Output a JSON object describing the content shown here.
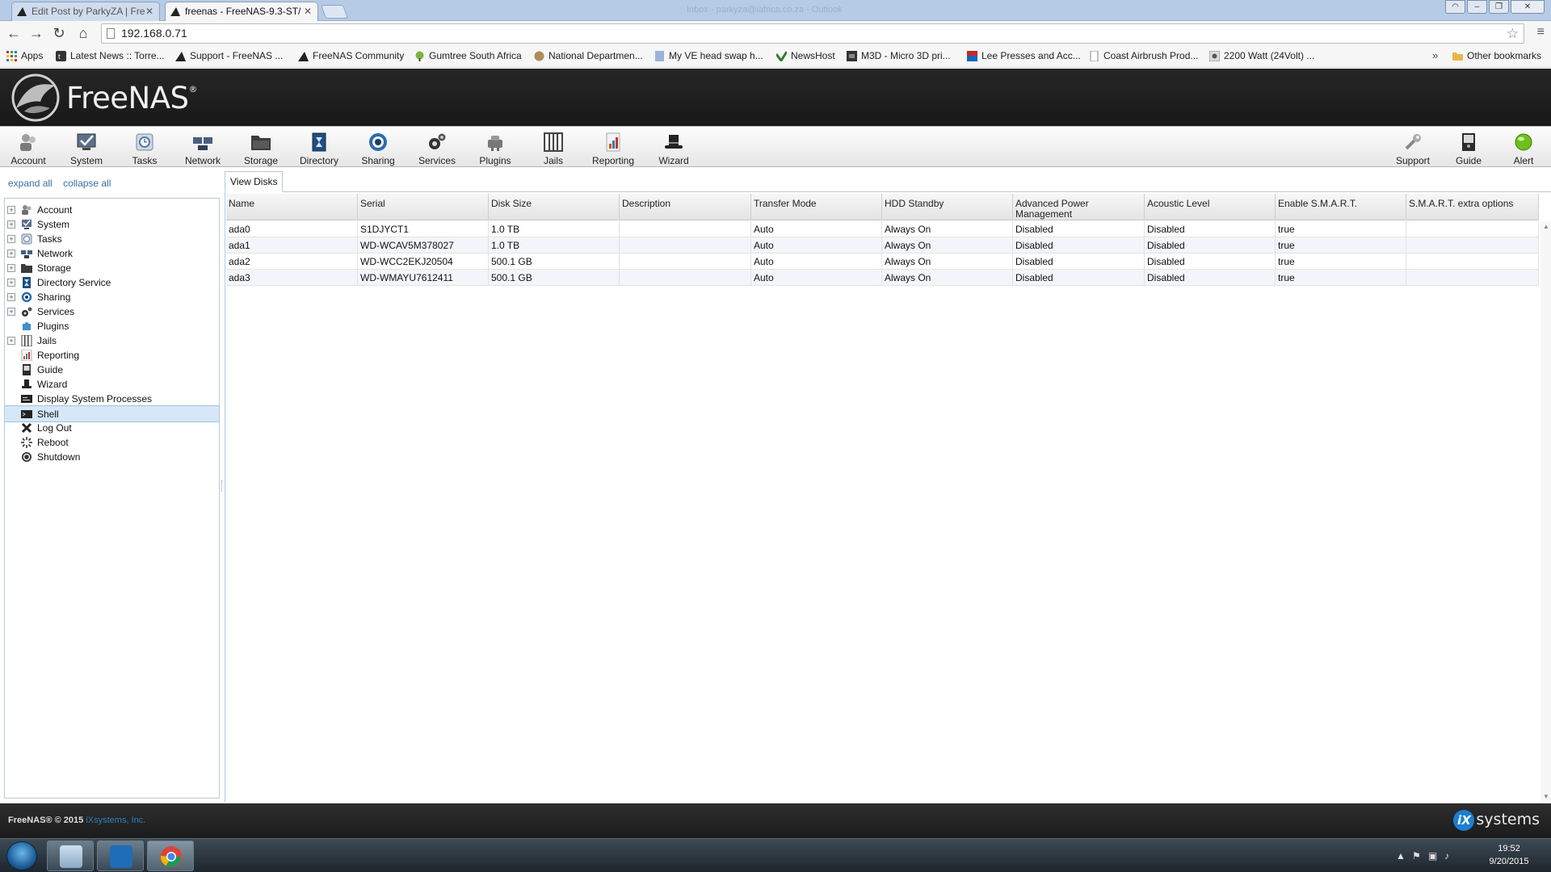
{
  "browser": {
    "tabs": [
      {
        "label": "Edit Post by ParkyZA | Fre",
        "active": false
      },
      {
        "label": "freenas - FreeNAS-9.3-ST/",
        "active": true
      }
    ],
    "window_title": "Inbox - parkyza@iafrica.co.za - Outlook",
    "url": "192.168.0.71",
    "bookmarks": [
      "Apps",
      "Latest News :: Torre...",
      "Support - FreeNAS ...",
      "FreeNAS Community",
      "Gumtree South Africa",
      "National Departmen...",
      "My VE head swap h...",
      "NewsHost",
      "M3D - Micro 3D pri...",
      "Lee Presses and Acc...",
      "Coast Airbrush Prod...",
      "2200 Watt (24Volt) ...",
      "Other bookmarks"
    ],
    "overflow": "»"
  },
  "freenas": {
    "logo": "FreeNAS",
    "logo_reg": "®",
    "menu_left": [
      "Account",
      "System",
      "Tasks",
      "Network",
      "Storage",
      "Directory",
      "Sharing",
      "Services",
      "Plugins",
      "Jails",
      "Reporting",
      "Wizard"
    ],
    "menu_right": [
      "Support",
      "Guide",
      "Alert"
    ],
    "tree_links": {
      "expand": "expand all",
      "collapse": "collapse all"
    },
    "tree": [
      {
        "label": "Account",
        "expandable": true
      },
      {
        "label": "System",
        "expandable": true
      },
      {
        "label": "Tasks",
        "expandable": true
      },
      {
        "label": "Network",
        "expandable": true
      },
      {
        "label": "Storage",
        "expandable": true
      },
      {
        "label": "Directory Service",
        "expandable": true
      },
      {
        "label": "Sharing",
        "expandable": true
      },
      {
        "label": "Services",
        "expandable": true
      },
      {
        "label": "Plugins",
        "expandable": false
      },
      {
        "label": "Jails",
        "expandable": true
      },
      {
        "label": "Reporting",
        "expandable": false
      },
      {
        "label": "Guide",
        "expandable": false
      },
      {
        "label": "Wizard",
        "expandable": false
      },
      {
        "label": "Display System Processes",
        "expandable": false
      },
      {
        "label": "Shell",
        "expandable": false,
        "selected": true
      },
      {
        "label": "Log Out",
        "expandable": false
      },
      {
        "label": "Reboot",
        "expandable": false
      },
      {
        "label": "Shutdown",
        "expandable": false
      }
    ],
    "view_tab": "View Disks",
    "table": {
      "columns": [
        "Name",
        "Serial",
        "Disk Size",
        "Description",
        "Transfer Mode",
        "HDD Standby",
        "Advanced Power Management",
        "Acoustic Level",
        "Enable S.M.A.R.T.",
        "S.M.A.R.T. extra options"
      ],
      "rows": [
        [
          "ada0",
          "S1DJYCT1",
          "1.0 TB",
          "",
          "Auto",
          "Always On",
          "Disabled",
          "Disabled",
          "true",
          ""
        ],
        [
          "ada1",
          "WD-WCAV5M378027",
          "1.0 TB",
          "",
          "Auto",
          "Always On",
          "Disabled",
          "Disabled",
          "true",
          ""
        ],
        [
          "ada2",
          "WD-WCC2EKJ20504",
          "500.1 GB",
          "",
          "Auto",
          "Always On",
          "Disabled",
          "Disabled",
          "true",
          ""
        ],
        [
          "ada3",
          "WD-WMAYU7612411",
          "500.1 GB",
          "",
          "Auto",
          "Always On",
          "Disabled",
          "Disabled",
          "true",
          ""
        ]
      ]
    },
    "footer": {
      "copyright": "FreeNAS® © 2015",
      "company": "iXsystems, Inc.",
      "brand": "systems",
      "brand_mark": "iX"
    }
  },
  "taskbar": {
    "time": "19:52",
    "date": "9/20/2015"
  },
  "colors": {
    "accent": "#3a6ea5",
    "header_bg": "#1f1f1f",
    "selected_row": "#d6e7f8"
  }
}
